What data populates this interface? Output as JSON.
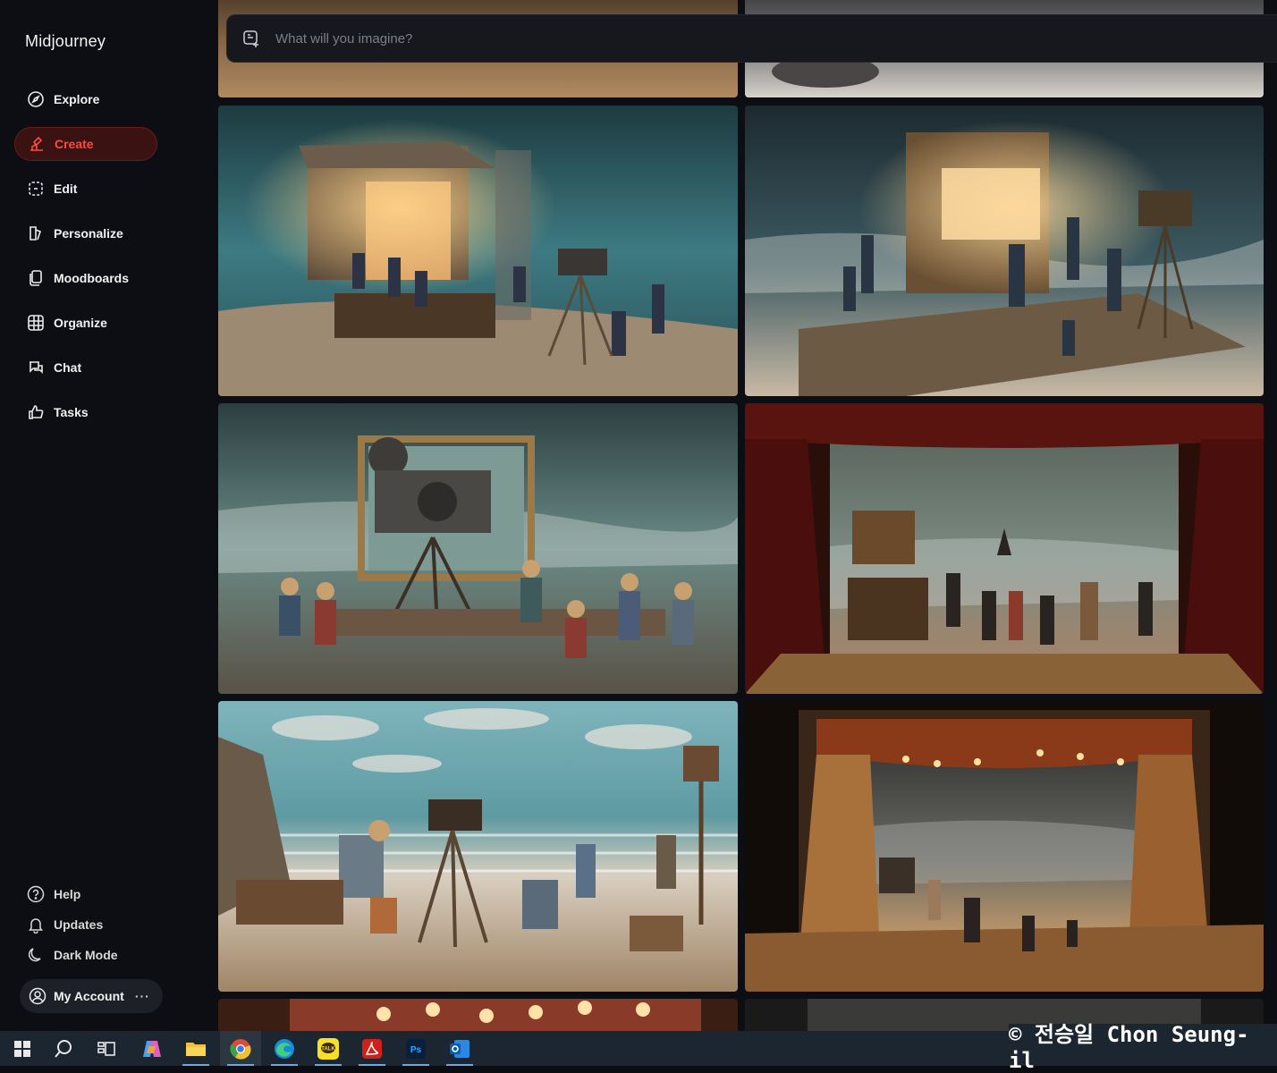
{
  "brand": "Midjourney",
  "nav": {
    "explore": "Explore",
    "create": "Create",
    "edit": "Edit",
    "personalize": "Personalize",
    "moodboards": "Moodboards",
    "organize": "Organize",
    "chat": "Chat",
    "tasks": "Tasks"
  },
  "footer": {
    "help": "Help",
    "updates": "Updates",
    "dark_mode": "Dark Mode",
    "account": "My Account",
    "account_menu": "···"
  },
  "prompt": {
    "placeholder": "What will you imagine?"
  },
  "colors": {
    "accent": "#ff4a3d",
    "sidebar_bg": "#0c0e13",
    "active_bg": "#3a1212"
  },
  "taskbar": {
    "apps": [
      "windows-start",
      "search",
      "task-view",
      "copilot",
      "file-explorer",
      "chrome",
      "edge",
      "kakaotalk",
      "acrobat",
      "photoshop",
      "outlook"
    ]
  },
  "watermark": "© 전승일 Chon Seung-il"
}
